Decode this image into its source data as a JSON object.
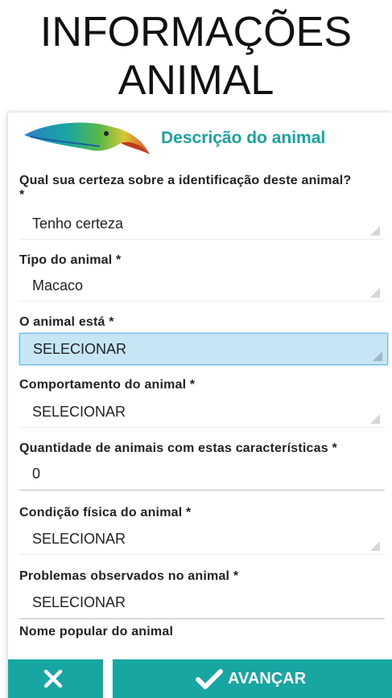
{
  "header": {
    "line1": "INFORMAÇÕES",
    "line2": "ANIMAL"
  },
  "card": {
    "title": "Descrição do animal"
  },
  "fields": {
    "certeza": {
      "label": "Qual sua certeza sobre a identificação deste animal?",
      "required": "*",
      "value": "Tenho certeza"
    },
    "tipo": {
      "label": "Tipo do animal *",
      "value": "Macaco"
    },
    "estado": {
      "label": "O animal está *",
      "value": "SELECIONAR"
    },
    "comportamento": {
      "label": "Comportamento do animal *",
      "value": "SELECIONAR"
    },
    "quantidade": {
      "label": "Quantidade de animais com estas características *",
      "value": "0"
    },
    "condicao": {
      "label": "Condição física do animal *",
      "value": "SELECIONAR"
    },
    "problemas": {
      "label": "Problemas observados no animal *",
      "value": "SELECIONAR"
    },
    "nome_popular": {
      "label": "Nome popular do animal"
    }
  },
  "buttons": {
    "next_label": "AVANÇAR",
    "cancel_icon": "close-icon",
    "next_icon": "check-icon"
  },
  "colors": {
    "accent": "#17a6a2",
    "title_teal": "#1aa3a0",
    "active_select": "#c6e5f5"
  }
}
